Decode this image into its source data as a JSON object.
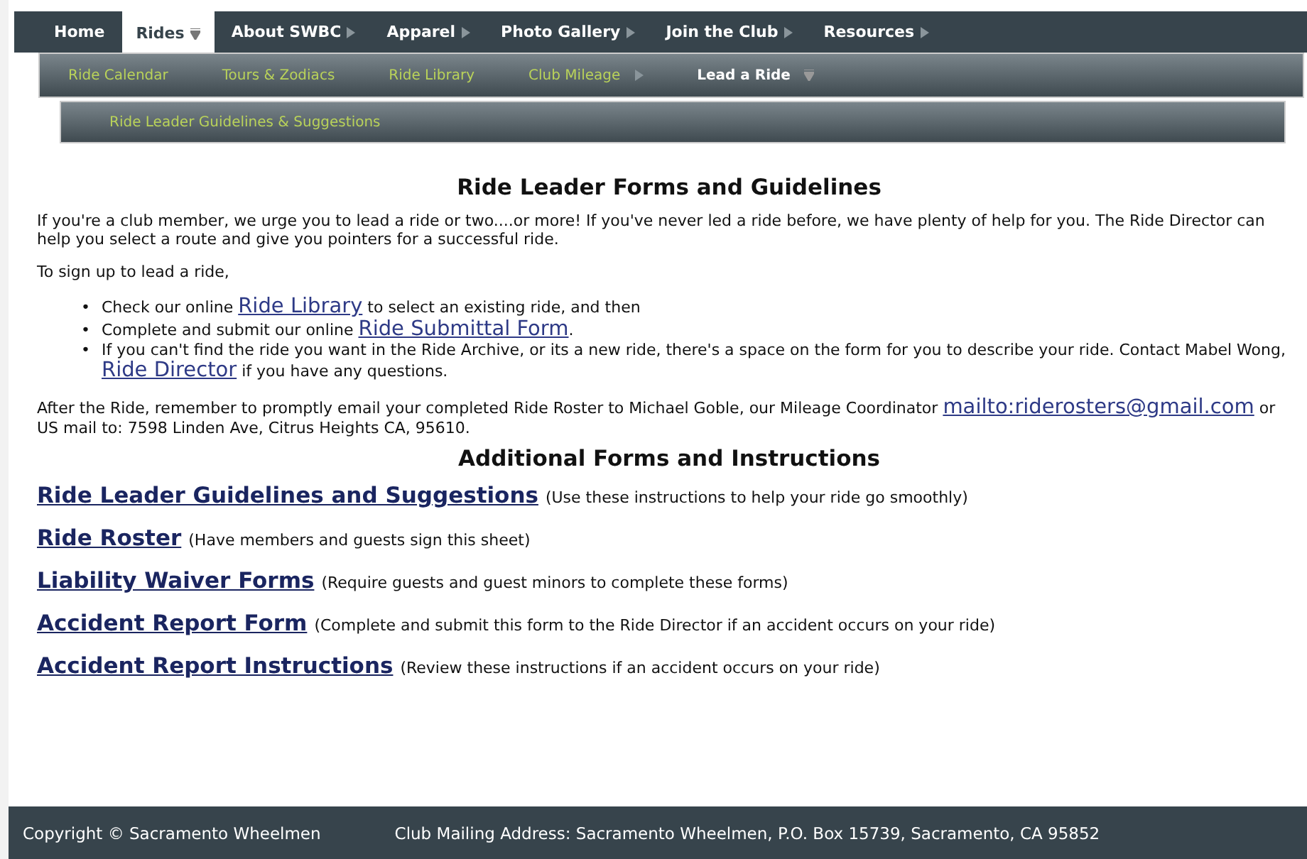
{
  "nav": {
    "items": [
      {
        "label": "Home",
        "selected": false,
        "kind": "link"
      },
      {
        "label": "Rides",
        "selected": true,
        "kind": "dropdown"
      },
      {
        "label": "About SWBC",
        "selected": false,
        "kind": "submenu"
      },
      {
        "label": "Apparel",
        "selected": false,
        "kind": "submenu"
      },
      {
        "label": "Photo Gallery",
        "selected": false,
        "kind": "submenu"
      },
      {
        "label": "Join the Club",
        "selected": false,
        "kind": "submenu"
      },
      {
        "label": "Resources",
        "selected": false,
        "kind": "submenu"
      }
    ],
    "subitems": [
      {
        "label": "Ride Calendar",
        "selected": false,
        "kind": "link"
      },
      {
        "label": "Tours & Zodiacs",
        "selected": false,
        "kind": "link"
      },
      {
        "label": "Ride Library",
        "selected": false,
        "kind": "link"
      },
      {
        "label": "Club Mileage",
        "selected": false,
        "kind": "submenu"
      },
      {
        "label": "Lead a Ride",
        "selected": true,
        "kind": "dropdown"
      }
    ],
    "subsubitems": [
      {
        "label": "Ride Leader Guidelines & Suggestions",
        "selected": false
      }
    ]
  },
  "title": "Ride Leader Forms and Guidelines",
  "intro": [
    [
      {
        "text": "If you're a club member, we urge you to lead a ride or two....or more! If you've never led a ride before, we have plenty of help for you. The Ride Director can help you select a route and give you pointers for a successful ride.",
        "link": false
      }
    ],
    [
      {
        "text": "To sign up to lead a ride,",
        "link": false
      }
    ]
  ],
  "bullets": [
    {
      "marker": "•",
      "segments": [
        {
          "text": "Check our online ",
          "link": false
        },
        {
          "text": "Ride Library",
          "link": true
        },
        {
          "text": " to select an existing ride, and then",
          "link": false
        }
      ]
    },
    {
      "marker": "•",
      "segments": [
        {
          "text": "Complete and submit our online ",
          "link": false
        },
        {
          "text": "Ride Submittal Form",
          "link": true
        },
        {
          "text": ".",
          "link": false
        }
      ]
    },
    {
      "marker": "•",
      "segments": [
        {
          "text": "If you can't find the ride you want in the Ride Archive, or its a new ride, there's a space on the form for you to describe your ride. Contact Mabel Wong, ",
          "link": false
        },
        {
          "text": "Ride Director",
          "link": true
        },
        {
          "text": " if you have any questions.",
          "link": false
        }
      ]
    }
  ],
  "after": [
    {
      "text": "After the Ride, remember to promptly email your completed Ride Roster to Michael Goble, our Mileage Coordinator ",
      "link": false
    },
    {
      "text": "mailto:riderosters@gmail.com",
      "link": true
    },
    {
      "text": " or US mail to: 7598 Linden Ave, Citrus Heights CA, 95610.",
      "link": false
    }
  ],
  "subtitle": "Additional Forms and Instructions",
  "forms": [
    {
      "link": "Ride Leader Guidelines and Suggestions",
      "note": "(Use these instructions to help your ride go smoothly)"
    },
    {
      "link": "Ride Roster",
      "note": "(Have members and guests sign this sheet)"
    },
    {
      "link": "Liability Waiver Forms",
      "note": "(Require guests and guest minors to complete these forms)"
    },
    {
      "link": "Accident Report Form",
      "note": "(Complete and submit this form to the Ride Director if an accident occurs on your ride)"
    },
    {
      "link": "Accident Report Instructions",
      "note": "(Review these instructions if an accident occurs on your ride)"
    }
  ],
  "footer": {
    "copyright": "Copyright © Sacramento Wheelmen",
    "address": "Club Mailing Address: Sacramento Wheelmen, P.O. Box 15739, Sacramento, CA 95852"
  }
}
